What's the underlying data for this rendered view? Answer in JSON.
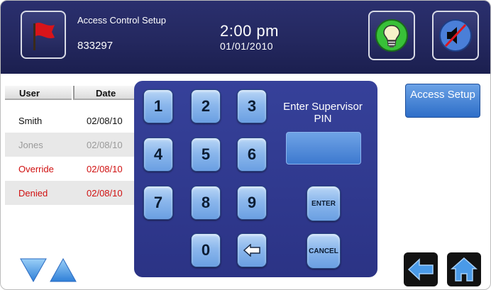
{
  "header": {
    "title": "Access Control Setup",
    "code": "833297",
    "time": "2:00 pm",
    "date": "01/01/2010",
    "icons": [
      "flag-icon",
      "lightbulb-icon",
      "speaker-mute-icon"
    ]
  },
  "table": {
    "headers": {
      "user": "User",
      "date": "Date"
    },
    "rows": [
      {
        "user": "Smith",
        "date": "02/08/10"
      },
      {
        "user": "Jones",
        "date": "02/08/10"
      },
      {
        "user": "Override",
        "date": "02/08/10"
      },
      {
        "user": "Denied",
        "date": "02/08/10"
      }
    ]
  },
  "keypad": {
    "keys": [
      "1",
      "2",
      "3",
      "4",
      "5",
      "6",
      "7",
      "8",
      "9",
      "0"
    ],
    "enter": "ENTER",
    "cancel": "CANCEL",
    "pin_label": "Enter Supervisor PIN",
    "pin_value": ""
  },
  "access_setup": {
    "label": "Access Setup"
  },
  "colors": {
    "header": "#24285f",
    "panel": "#2f3890",
    "alert": "#d01010",
    "key": "#8bb7ec"
  }
}
